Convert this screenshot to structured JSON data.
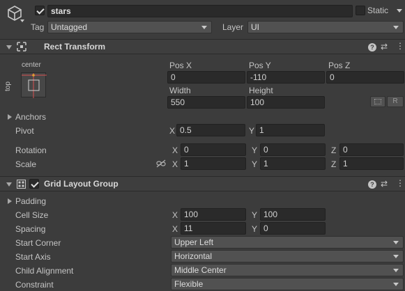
{
  "object": {
    "active": true,
    "name": "stars",
    "static_label": "Static",
    "static_checked": false,
    "tag_label": "Tag",
    "tag_value": "Untagged",
    "layer_label": "Layer",
    "layer_value": "UI"
  },
  "rect_transform": {
    "title": "Rect Transform",
    "anchor_preset_top": "center",
    "anchor_preset_side": "top",
    "pos_x_label": "Pos X",
    "pos_y_label": "Pos Y",
    "pos_z_label": "Pos Z",
    "pos_x": "0",
    "pos_y": "-110",
    "pos_z": "0",
    "width_label": "Width",
    "height_label": "Height",
    "width": "550",
    "height": "100",
    "raw_button": "R",
    "anchors_label": "Anchors",
    "pivot_label": "Pivot",
    "pivot_x": "0.5",
    "pivot_y": "1",
    "rotation_label": "Rotation",
    "rotation": {
      "x": "0",
      "y": "0",
      "z": "0"
    },
    "scale_label": "Scale",
    "scale": {
      "x": "1",
      "y": "1",
      "z": "1"
    },
    "axis_x": "X",
    "axis_y": "Y",
    "axis_z": "Z"
  },
  "grid_layout": {
    "title": "Grid Layout Group",
    "enabled": true,
    "padding_label": "Padding",
    "cell_size_label": "Cell Size",
    "cell_size_x": "100",
    "cell_size_y": "100",
    "spacing_label": "Spacing",
    "spacing_x": "11",
    "spacing_y": "0",
    "start_corner_label": "Start Corner",
    "start_corner": "Upper Left",
    "start_axis_label": "Start Axis",
    "start_axis": "Horizontal",
    "child_alignment_label": "Child Alignment",
    "child_alignment": "Middle Center",
    "constraint_label": "Constraint",
    "constraint": "Flexible"
  },
  "icons": {
    "gameobject": "cube-icon",
    "rect_transform": "rect-transform-icon",
    "grid_layout": "grid-layout-icon",
    "help": "help-icon",
    "presets": "presets-icon",
    "menu": "kebab-menu-icon",
    "link": "unlink-icon",
    "blueprint": "blueprint-mode-icon"
  },
  "colors": {
    "background": "#3c3c3c",
    "field": "#2a2a2a",
    "anchor_preset_red": "#d85050",
    "anchor_preset_pivot": "#e0a030"
  }
}
